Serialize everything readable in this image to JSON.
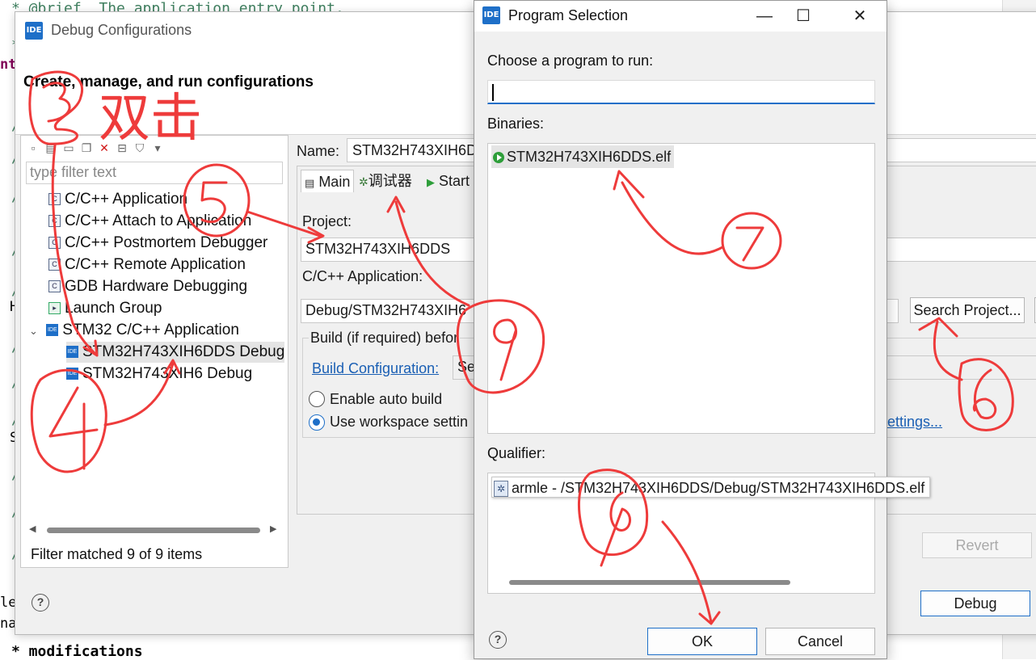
{
  "editor": {
    "line_top": "* @brief  The application entry point.",
    "gutter_chars": [
      "*",
      "nt",
      "/",
      "/",
      "/",
      "/",
      "/",
      "H",
      "/",
      "/",
      "/",
      "S",
      "/",
      "/",
      "/",
      "le",
      "nat"
    ],
    "bottom_text": "* modifications"
  },
  "debug_window": {
    "app_icon_label": "IDE",
    "title": "Debug Configurations",
    "header": "Create, manage, and run configurations",
    "filter_placeholder": "type filter text",
    "tree": [
      {
        "label": "C/C++ Application"
      },
      {
        "label": "C/C++ Attach to Application"
      },
      {
        "label": "C/C++ Postmortem Debugger"
      },
      {
        "label": "C/C++ Remote Application"
      },
      {
        "label": "GDB Hardware Debugging"
      },
      {
        "label": "Launch Group"
      },
      {
        "label": "STM32 C/C++ Application"
      },
      {
        "label": "STM32H743XIH6DDS Debug"
      },
      {
        "label": "STM32H743XIH6 Debug"
      }
    ],
    "status": "Filter matched 9 of 9 items",
    "name_label": "Name:",
    "name_value": "STM32H743XIH6D",
    "tabs": [
      "Main",
      "调试器",
      "Start"
    ],
    "project_label": "Project:",
    "project_value": "STM32H743XIH6DDS",
    "app_label": "C/C++ Application:",
    "app_value": "Debug/STM32H743XIH6",
    "search_project_button": "Search Project...",
    "build_group_label": "Build (if required) befor",
    "build_config_link": "Build Configuration:",
    "build_config_value": "Se",
    "radio_auto_build": "Enable auto build",
    "radio_workspace": "Use workspace settin",
    "settings_link": "ettings...",
    "revert_button": "Revert",
    "debug_button": "Debug",
    "help_glyph": "?"
  },
  "program_selection": {
    "app_icon_label": "IDE",
    "title": "Program Selection",
    "choose_label": "Choose a program to run:",
    "search_value": "",
    "binaries_label": "Binaries:",
    "binaries": [
      "STM32H743XIH6DDS.elf"
    ],
    "qualifier_label": "Qualifier:",
    "qualifiers": [
      "armle - /STM32H743XIH6DDS/Debug/STM32H743XIH6DDS.elf"
    ],
    "ok_button": "OK",
    "cancel_button": "Cancel",
    "help_glyph": "?",
    "minimize_glyph": "—",
    "maximize_glyph": "☐",
    "close_glyph": "✕"
  },
  "annotations": {
    "color": "#ee3b3b",
    "double_click_note": "双击"
  }
}
